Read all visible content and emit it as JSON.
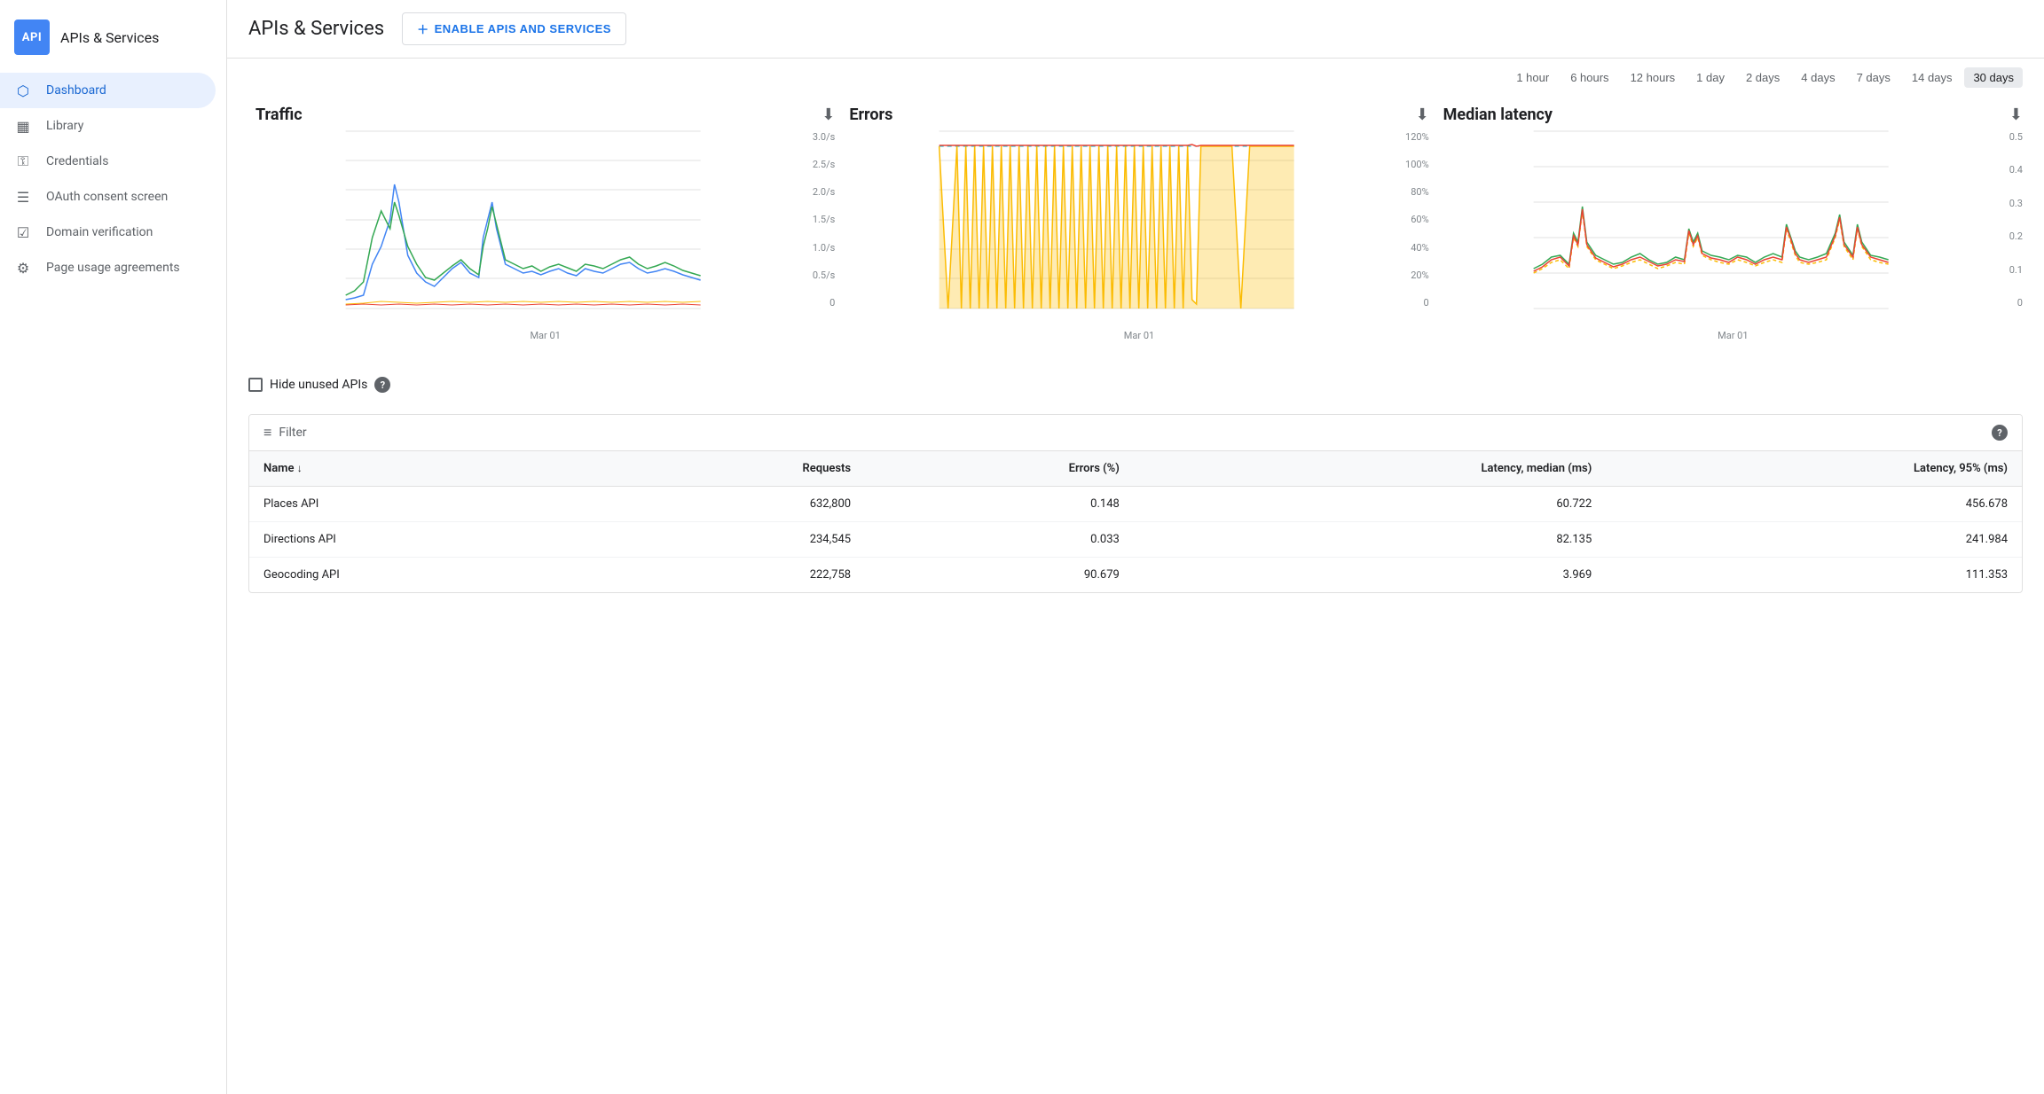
{
  "sidebar": {
    "logo_text": "API",
    "title": "APIs & Services",
    "items": [
      {
        "id": "dashboard",
        "label": "Dashboard",
        "icon": "⬡",
        "active": true
      },
      {
        "id": "library",
        "label": "Library",
        "icon": "▦"
      },
      {
        "id": "credentials",
        "label": "Credentials",
        "icon": "⚿"
      },
      {
        "id": "oauth",
        "label": "OAuth consent screen",
        "icon": "☰"
      },
      {
        "id": "domain",
        "label": "Domain verification",
        "icon": "☑"
      },
      {
        "id": "page-usage",
        "label": "Page usage agreements",
        "icon": "⚙"
      }
    ]
  },
  "header": {
    "title": "APIs & Services",
    "enable_button": "ENABLE APIS AND SERVICES"
  },
  "time_filter": {
    "options": [
      "1 hour",
      "6 hours",
      "12 hours",
      "1 day",
      "2 days",
      "4 days",
      "7 days",
      "14 days",
      "30 days"
    ],
    "active": "30 days"
  },
  "charts": {
    "traffic": {
      "title": "Traffic",
      "y_labels": [
        "3.0/s",
        "2.5/s",
        "2.0/s",
        "1.5/s",
        "1.0/s",
        "0.5/s",
        "0"
      ],
      "x_label": "Mar 01"
    },
    "errors": {
      "title": "Errors",
      "y_labels": [
        "120%",
        "100%",
        "80%",
        "60%",
        "40%",
        "20%",
        "0"
      ],
      "x_label": "Mar 01"
    },
    "latency": {
      "title": "Median latency",
      "y_labels": [
        "0.5",
        "0.4",
        "0.3",
        "0.2",
        "0.1",
        "0"
      ],
      "x_label": "Mar 01"
    }
  },
  "table": {
    "hide_unused_label": "Hide unused APIs",
    "filter_placeholder": "Filter",
    "help_symbol": "?",
    "columns": [
      {
        "id": "name",
        "label": "Name",
        "sortable": true
      },
      {
        "id": "requests",
        "label": "Requests",
        "sortable": true,
        "align": "right"
      },
      {
        "id": "errors",
        "label": "Errors (%)",
        "align": "right"
      },
      {
        "id": "latency_median",
        "label": "Latency, median (ms)",
        "align": "right"
      },
      {
        "id": "latency_95",
        "label": "Latency, 95% (ms)",
        "align": "right"
      }
    ],
    "rows": [
      {
        "name": "Places API",
        "requests": "632,800",
        "errors": "0.148",
        "latency_median": "60.722",
        "latency_95": "456.678"
      },
      {
        "name": "Directions API",
        "requests": "234,545",
        "errors": "0.033",
        "latency_median": "82.135",
        "latency_95": "241.984"
      },
      {
        "name": "Geocoding API",
        "requests": "222,758",
        "errors": "90.679",
        "latency_median": "3.969",
        "latency_95": "111.353"
      }
    ]
  }
}
